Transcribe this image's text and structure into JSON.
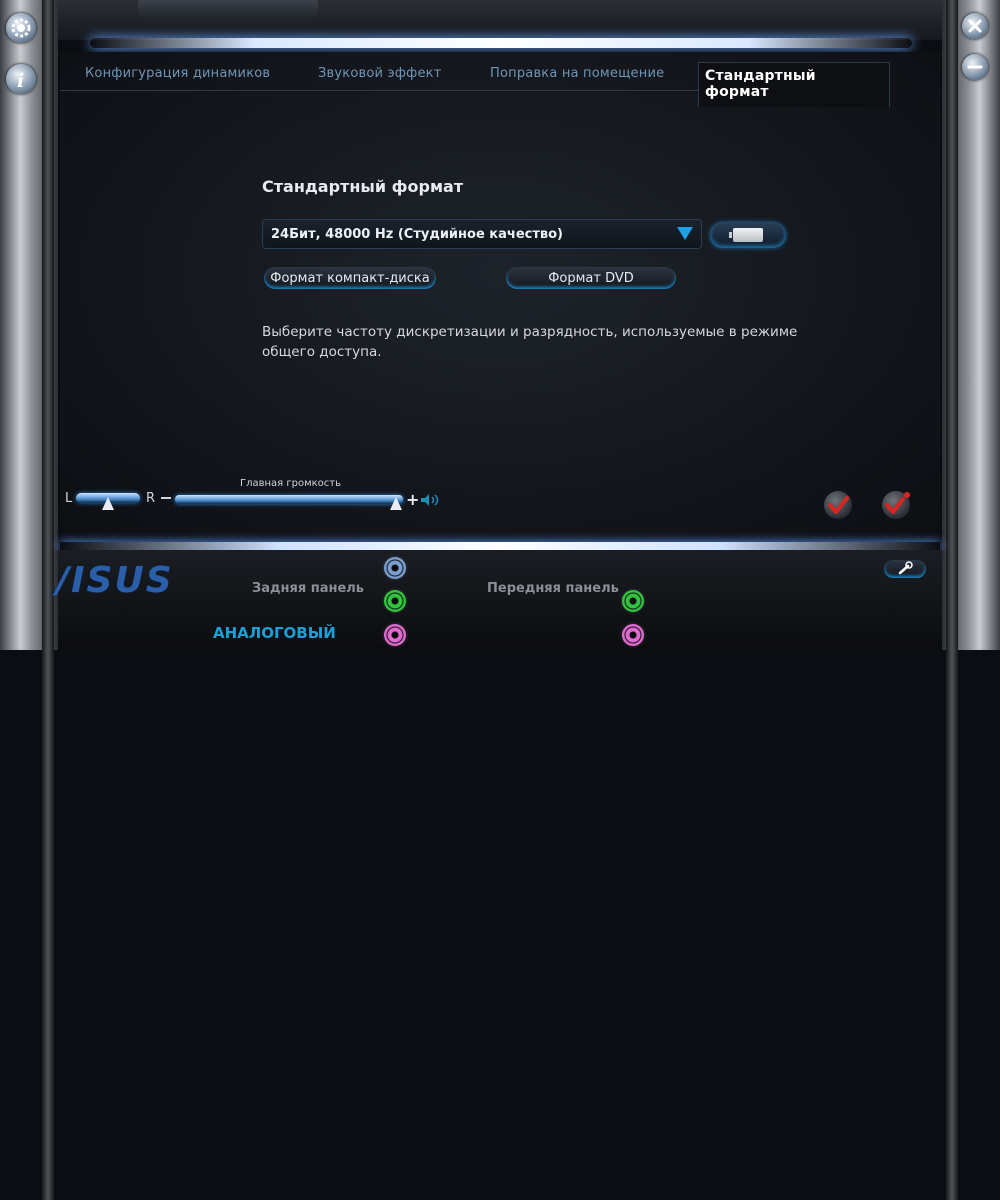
{
  "tabs": [
    {
      "label": "Конфигурация динамиков"
    },
    {
      "label": "Звуковой эффект"
    },
    {
      "label": "Поправка на помещение"
    },
    {
      "label": "Стандартный формат"
    }
  ],
  "section": {
    "title": "Стандартный формат",
    "format_value": "24Бит, 48000 Hz (Студийное качество)",
    "cd_button": "Формат компакт-диска",
    "dvd_button": "Формат DVD",
    "description": "Выберите частоту дискретизации и разрядность, используемые в режиме общего доступа."
  },
  "volume": {
    "left_label": "L",
    "right_label": "R",
    "master_label": "Главная громкость",
    "balance": 0.5,
    "master_level": 0.97
  },
  "bottom": {
    "logo": "/ISUS",
    "rear_panel": "Задняя панель",
    "front_panel": "Передняя панель",
    "analog": "АНАЛОГОВЫЙ"
  },
  "colors": {
    "accent": "#1fa0e6",
    "jack_blue": "#7a9fd1",
    "jack_green": "#32c43f",
    "jack_pink": "#e06bd0"
  }
}
